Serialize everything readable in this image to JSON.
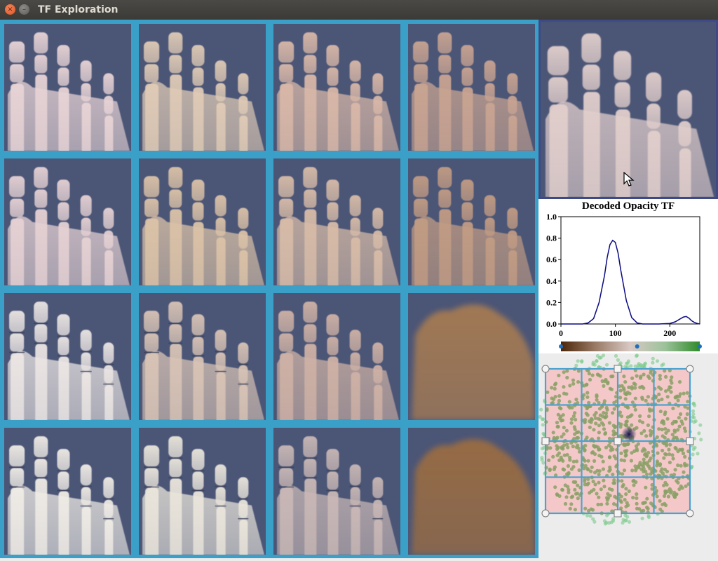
{
  "window": {
    "title": "TF Exploration"
  },
  "icons": {
    "close": "close-icon",
    "minimize": "minimize-icon",
    "cursor": "mouse-cursor-icon"
  },
  "colors": {
    "grid_border": "#3aa0c8",
    "render_background": "#4b5576",
    "preview_border": "#3d4a86",
    "curve": "#0a0a80",
    "explorer_fill": "#f4c8c8",
    "explorer_points": "#7aa060"
  },
  "thumbnails": {
    "rows": 4,
    "cols": 4,
    "tints": [
      [
        "#e8d4d6",
        "#e0cbb6",
        "#d9b8a8",
        "#c9a492"
      ],
      [
        "#e6d2d4",
        "#dcc3a8",
        "#d8bca8",
        "#c29c84"
      ],
      [
        "#ece6e4",
        "#d9c4b6",
        "#cfb2a6",
        "#a57a52"
      ],
      [
        "#f0ece6",
        "#ebe6dc",
        "#c9b8b6",
        "#9a6c42"
      ]
    ],
    "styles": [
      [
        "solid",
        "solid",
        "solid",
        "solid"
      ],
      [
        "solid",
        "solid",
        "solid",
        "solid"
      ],
      [
        "bony",
        "bony",
        "solid",
        "soft"
      ],
      [
        "bony",
        "bony",
        "bony",
        "soft"
      ]
    ]
  },
  "preview": {
    "label": "selected-render"
  },
  "chart_data": {
    "type": "line",
    "title": "Decoded Opacity TF",
    "xlabel": "",
    "ylabel": "",
    "xlim": [
      0,
      255
    ],
    "ylim": [
      0,
      1
    ],
    "xticks": [
      0,
      100,
      200
    ],
    "yticks": [
      0.0,
      0.2,
      0.4,
      0.6,
      0.8,
      1.0
    ],
    "ytick_labels": [
      "0.0",
      "0.2",
      "0.4",
      "0.6",
      "0.8",
      "1.0"
    ],
    "series": [
      {
        "x": [
          0,
          20,
          40,
          50,
          60,
          70,
          80,
          85,
          90,
          95,
          100,
          105,
          110,
          120,
          130,
          140,
          150,
          160,
          180,
          200,
          210,
          215,
          220,
          225,
          230,
          235,
          240,
          245,
          250,
          255
        ],
        "y": [
          0,
          0,
          0,
          0.01,
          0.05,
          0.2,
          0.45,
          0.62,
          0.74,
          0.78,
          0.76,
          0.66,
          0.5,
          0.22,
          0.06,
          0.01,
          0,
          0,
          0,
          0.005,
          0.02,
          0.035,
          0.05,
          0.065,
          0.07,
          0.055,
          0.03,
          0.015,
          0.005,
          0
        ]
      }
    ],
    "colormap": {
      "stops": [
        "#4b2508",
        "#9a7b66",
        "#d8c8c4",
        "#9cc29a",
        "#2f8a2a"
      ],
      "control_points": [
        0,
        140,
        255
      ]
    }
  },
  "explorer": {
    "grid_divisions": 4,
    "selected_marker": [
      0.5,
      0.5
    ],
    "handles": [
      "top-left",
      "top-mid",
      "top-right",
      "mid-left",
      "center",
      "mid-right",
      "bottom-left",
      "bottom-mid",
      "bottom-right"
    ]
  }
}
